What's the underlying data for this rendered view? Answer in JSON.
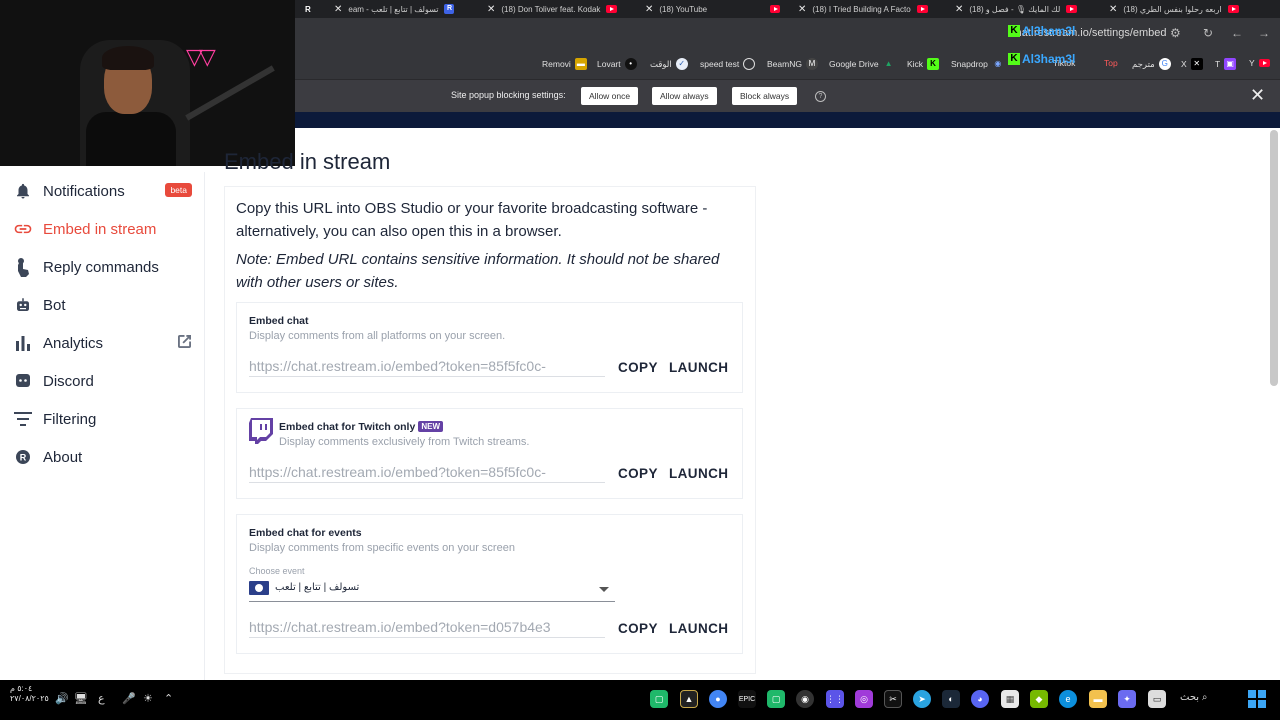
{
  "browser": {
    "tabs": [
      {
        "label": "eam - تسولف | تتابع | تلعب",
        "icon": "restream-favicon"
      },
      {
        "label": "(18) Don Toliver feat. Kodak",
        "icon": "youtube-icon"
      },
      {
        "label": "(18) YouTube",
        "icon": "youtube-icon"
      },
      {
        "label": "(18) I Tried Building A Facto",
        "icon": "youtube-icon"
      },
      {
        "label": "(18) لك المايك 🎙 - فصل و",
        "icon": "youtube-icon"
      },
      {
        "label": "(18) اربعه رحلوا بنفس الطري",
        "icon": "youtube-icon"
      }
    ],
    "url": "chat.restream.io/settings/embed",
    "overlay_text": "Al3ham3l",
    "bookmarks": [
      {
        "label": "Removi",
        "icon": "remove-icon"
      },
      {
        "label": "Lovart",
        "icon": "lovart-icon"
      },
      {
        "label": "الوقت",
        "icon": "time-icon"
      },
      {
        "label": "speed test",
        "icon": "speedtest-icon"
      },
      {
        "label": "BeamNG",
        "icon": "beamng-icon"
      },
      {
        "label": "Google Drive",
        "icon": "drive-icon"
      },
      {
        "label": "Kick",
        "icon": "kick-icon"
      },
      {
        "label": "Snapdrop",
        "icon": "snapdrop-icon"
      },
      {
        "label": "Tiktok",
        "icon": "tiktok-icon"
      },
      {
        "label": "Top",
        "icon": "top-icon"
      },
      {
        "label": "مترجم",
        "icon": "translate-icon"
      },
      {
        "label": "X",
        "icon": "x-icon"
      },
      {
        "label": "T",
        "icon": "twitch-icon"
      },
      {
        "label": "Y",
        "icon": "youtube-icon"
      }
    ],
    "popup": {
      "text": "Site popup blocking settings:",
      "allow_once": "Allow once",
      "allow_always": "Allow always",
      "block_always": "Block always"
    }
  },
  "sidebar": {
    "items": [
      {
        "label": "Notifications",
        "icon": "bell-icon",
        "badge": "beta"
      },
      {
        "label": "Embed in stream",
        "icon": "link-icon",
        "active": true
      },
      {
        "label": "Reply commands",
        "icon": "hand-pointer-icon"
      },
      {
        "label": "Bot",
        "icon": "robot-icon"
      },
      {
        "label": "Analytics",
        "icon": "bar-chart-icon"
      },
      {
        "label": "Discord",
        "icon": "discord-icon"
      },
      {
        "label": "Filtering",
        "icon": "filter-icon"
      },
      {
        "label": "About",
        "icon": "restream-logo-icon"
      }
    ]
  },
  "main": {
    "title": "Embed in stream",
    "intro": "Copy this URL into OBS Studio or your favorite broadcasting software - alternatively, you can also open this in a browser.",
    "note": "Note: Embed URL contains sensitive information. It should not be shared with other users or sites.",
    "embeds": [
      {
        "title": "Embed chat",
        "description": "Display comments from all platforms on your screen.",
        "url": "https://chat.restream.io/embed?token=85f5fc0c-",
        "copy": "COPY",
        "launch": "LAUNCH"
      },
      {
        "title": "Embed chat for Twitch only",
        "badge": "NEW",
        "description": "Display comments exclusively from Twitch streams.",
        "url": "https://chat.restream.io/embed?token=85f5fc0c-",
        "copy": "COPY",
        "launch": "LAUNCH"
      },
      {
        "title": "Embed chat for events",
        "description": "Display comments from specific events on your screen",
        "event_label": "Choose event",
        "event_value": "تسولف | تتابع | تلعب",
        "url": "https://chat.restream.io/embed?token=d057b4e3",
        "copy": "COPY",
        "launch": "LAUNCH"
      }
    ]
  },
  "taskbar": {
    "time": "٥:٠٤ م",
    "date": "٢٧/٠٨/٢٠٢٥",
    "search": "بحث",
    "lang": "ع"
  },
  "colors": {
    "accent": "#e84a3c",
    "text": "#1e2638",
    "twitch": "#6441a5"
  }
}
